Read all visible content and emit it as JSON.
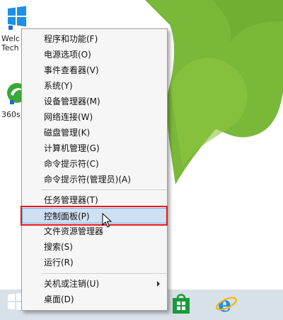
{
  "desktop": {
    "icons": [
      {
        "label": "Welc",
        "label2": "Tech"
      },
      {
        "label": "360s"
      }
    ]
  },
  "context_menu": {
    "items": [
      {
        "label": "程序和功能(F)"
      },
      {
        "label": "电源选项(O)"
      },
      {
        "label": "事件查看器(V)"
      },
      {
        "label": "系统(Y)"
      },
      {
        "label": "设备管理器(M)"
      },
      {
        "label": "网络连接(W)"
      },
      {
        "label": "磁盘管理(K)"
      },
      {
        "label": "计算机管理(G)"
      },
      {
        "label": "命令提示符(C)"
      },
      {
        "label": "命令提示符(管理员)(A)"
      },
      {
        "label": "任务管理器(T)"
      },
      {
        "label": "控制面板(P)"
      },
      {
        "label": "文件资源管理器"
      },
      {
        "label": "搜索(S)"
      },
      {
        "label": "运行(R)"
      },
      {
        "label": "关机或注销(U)"
      },
      {
        "label": "桌面(D)"
      }
    ],
    "highlighted_item": "控制面板(P)"
  },
  "colors": {
    "menu_background": "#f6f6f6",
    "highlight_fill": "#cfe0f2",
    "annotation_box": "#e01818",
    "wallpaper_green": "#7ab83a",
    "taskbar": "#d9e1e8"
  },
  "taskbar": {
    "icons": [
      "windows-start-icon",
      "store-icon",
      "internet-explorer-icon"
    ]
  }
}
